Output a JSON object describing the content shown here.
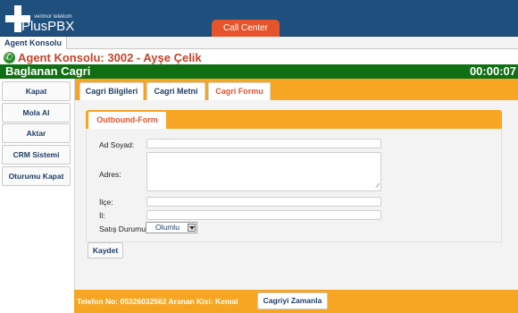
{
  "brand": {
    "tagline": "verimor telekom",
    "name": "PlusPBX"
  },
  "top_tabs": [
    "Call Center"
  ],
  "nav": {
    "item": "Agent Konsolu"
  },
  "agent": {
    "title": "Agent Konsolu: 3002 - Ayşe Çelik"
  },
  "status": {
    "title": "Baglanan Cagri",
    "timer": "00:00:07",
    "color": "#0f6f12"
  },
  "sidebar": {
    "items": [
      "Kapat",
      "Mola Al",
      "Aktar",
      "CRM Sistemi",
      "Oturumu Kapat"
    ]
  },
  "tabs": [
    {
      "label": "Cagri Bilgileri",
      "active": false
    },
    {
      "label": "Cagri Metni",
      "active": false
    },
    {
      "label": "Cagri Formu",
      "active": true
    }
  ],
  "form": {
    "tab_label": "Outbound-Form",
    "fields": {
      "name_label": "Ad Soyad:",
      "address_label": "Adres:",
      "district_label": "İlçe:",
      "city_label": "İl:",
      "sales_status_label": "Satış Durumu:",
      "sales_status_value": "Olumlu"
    },
    "save_label": "Kaydet"
  },
  "footer": {
    "text": "Telefon No: 05326032562 Aranan Kisi: Kemal",
    "schedule_label": "Cagriyi Zamanla"
  },
  "colors": {
    "header": "#1f4f7d",
    "accent_orange": "#f6a623",
    "accent_red": "#e5542b",
    "title_red": "#c4442a"
  },
  "icons": {
    "phone": "phone-icon",
    "logo": "plus-logo-icon"
  }
}
